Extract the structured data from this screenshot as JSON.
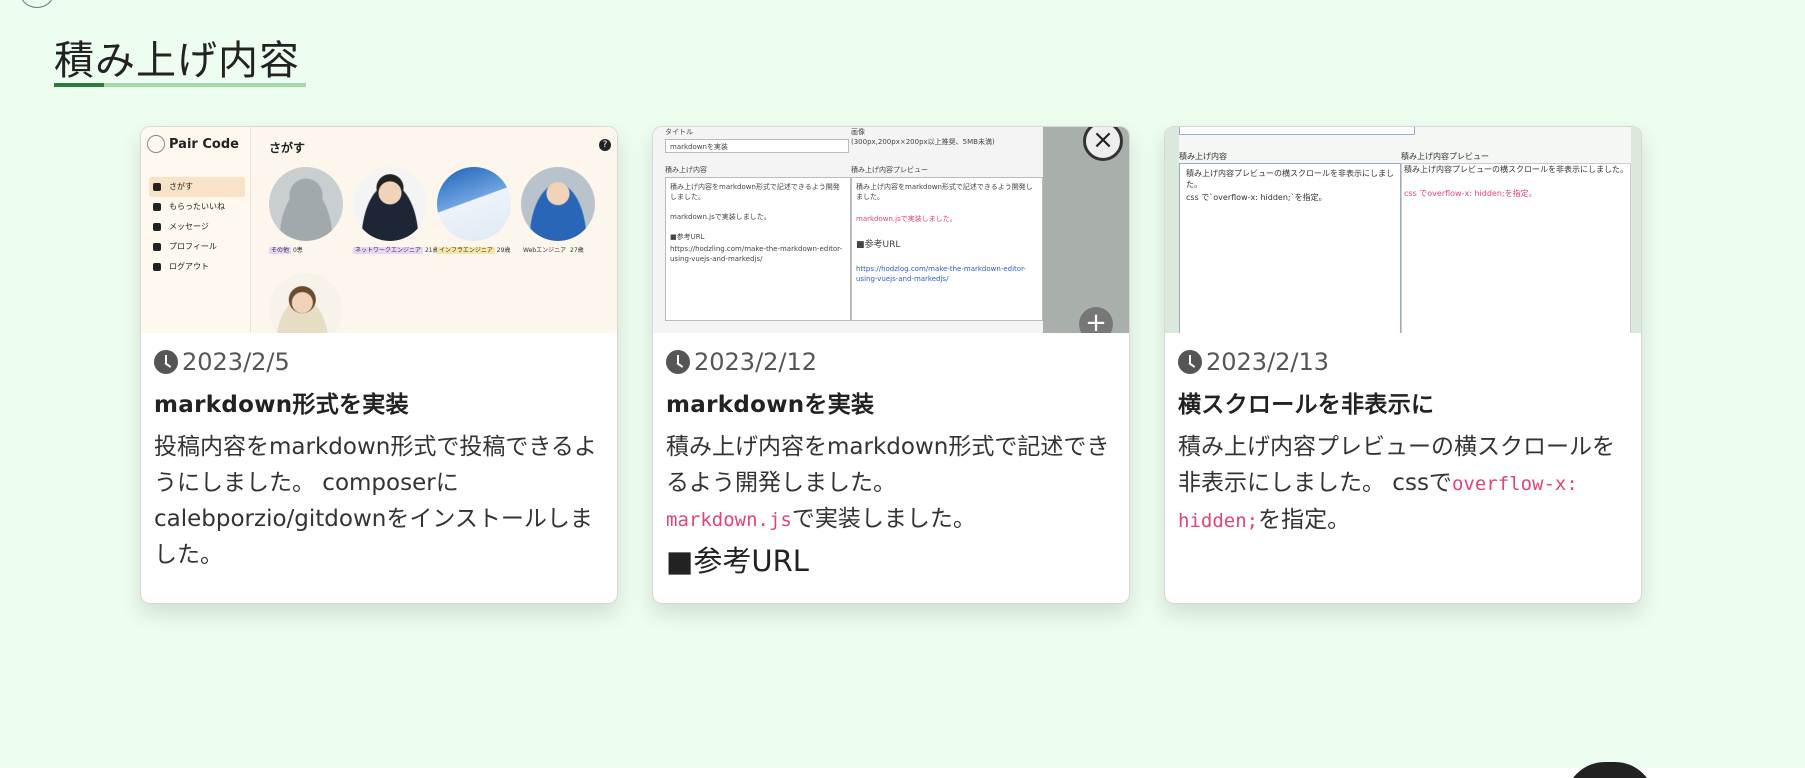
{
  "section": {
    "title": "積み上げ内容"
  },
  "cards": [
    {
      "date": "2023/2/5",
      "title": "markdown形式を実装",
      "desc": "投稿内容をmarkdown形式で投稿できるようにしました。 composerにcalebporzio/gitdownをインストールしました。",
      "thumb": {
        "app_name": "Pair Code",
        "heading": "さがす",
        "nav": [
          "さがす",
          "もらったいいね",
          "メッセージ",
          "プロフィール",
          "ログアウト"
        ],
        "users": [
          {
            "label": "その他",
            "count": "0患"
          },
          {
            "label": "ネットワークエンジニア",
            "count": "21歳"
          },
          {
            "label": "インフラエンジニア",
            "count": "29歳"
          },
          {
            "label": "Webエンジニア",
            "count": "27歳"
          }
        ]
      }
    },
    {
      "date": "2023/2/12",
      "title": "markdownを実装",
      "desc_pre": "積み上げ内容をmarkdown形式で記述できるよう開発しました。",
      "desc_code": "markdown.js",
      "desc_post": "で実装しました。",
      "ref_heading": "■参考URL",
      "thumb": {
        "title_label": "タイトル",
        "title_value": "markdownを実装",
        "image_label": "画像",
        "image_hint": "(300px,200px×200px以上推奨、5MB未満)",
        "content_label": "積み上げ内容",
        "content_value": "積み上げ内容をmarkdown形式で記述できるよう開発しました。",
        "content_value2": "markdown.jsで実装しました。",
        "content_value3": "■参考URL",
        "content_url": "https://hodzling.com/make-the-markdown-editor-using-vuejs-and-markedjs/",
        "preview_label": "積み上げ内容プレビュー",
        "preview_text": "積み上げ内容をmarkdown形式で記述できるよう開発しました。",
        "preview_code": "markdown.jsで実装しました。",
        "preview_ref": "■参考URL",
        "preview_url": "https://hodzlog.com/make-the-markdown-editor-using-vuejs-and-markedjs/"
      }
    },
    {
      "date": "2023/2/13",
      "title": "横スクロールを非表示に",
      "desc_pre": "積み上げ内容プレビューの横スクロールを非表示にしました。 cssで",
      "desc_code": "overflow-x: hidden;",
      "desc_post": "を指定。",
      "thumb": {
        "content_label": "積み上げ内容",
        "content_value": "積み上げ内容プレビューの横スクロールを非表示にしました。",
        "content_value2": "css で`overflow-x: hidden;`を指定。",
        "preview_label": "積み上げ内容プレビュー",
        "preview_text": "積み上げ内容プレビューの横スクロールを非表示にしました。",
        "preview_code": "css でoverflow-x: hidden;を指定。"
      }
    }
  ]
}
